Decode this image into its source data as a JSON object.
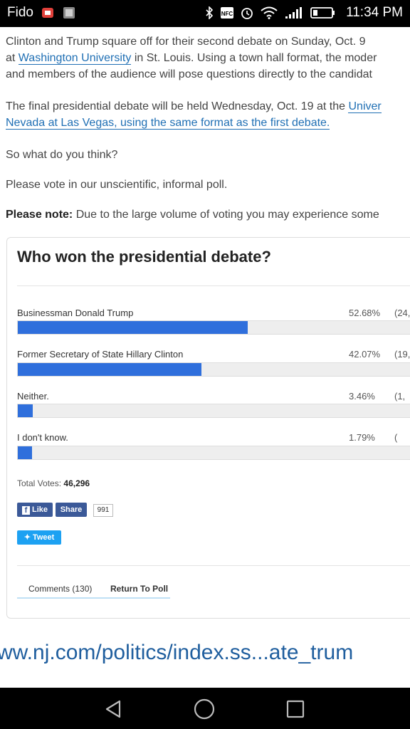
{
  "status_bar": {
    "carrier": "Fido",
    "time": "11:34 PM",
    "icons": [
      "app-notification-icon",
      "image-notification-icon",
      "bluetooth-icon",
      "nfc-icon",
      "alarm-icon",
      "wifi-icon",
      "signal-icon",
      "battery-icon"
    ]
  },
  "article": {
    "p1": {
      "line1": "Clinton and Trump square off for their second debate on Sunday, Oct. 9",
      "line2_pre": "at ",
      "line2_link": "Washington University",
      "line2_post": " in St. Louis. Using a town hall format, the moder",
      "line3": "and members of the audience will pose questions directly to the candidat"
    },
    "p2": {
      "line1_pre": "The final presidential debate will be held Wednesday, Oct. 19 at the ",
      "line1_link": "Univer",
      "line2_link": "Nevada at Las Vegas, using the same format as the first debate."
    },
    "p3": "So what do you think?",
    "p4": "Please vote in our unscientific, informal poll.",
    "p5": {
      "bold": "Please note:",
      "rest": " Due to the large volume of voting you may experience some"
    }
  },
  "poll": {
    "title": "Who won the presidential debate?",
    "options": [
      {
        "label": "Businessman Donald Trump",
        "percent_text": "52.68%",
        "count_text": "(24,",
        "fraction": 0.5268
      },
      {
        "label": "Former Secretary of State Hillary Clinton",
        "percent_text": "42.07%",
        "count_text": "(19,",
        "fraction": 0.4207
      },
      {
        "label": "Neither.",
        "percent_text": "3.46%",
        "count_text": "(1,",
        "fraction": 0.0346
      },
      {
        "label": "I don't know.",
        "percent_text": "1.79%",
        "count_text": "(",
        "fraction": 0.0179
      }
    ],
    "total_label": "Total Votes:",
    "total_value": "46,296",
    "like_label": "Like",
    "share_label": "Share",
    "share_count": "991",
    "tweet_label": "Tweet",
    "comments_label": "Comments (130)",
    "return_label": "Return To Poll",
    "bar_color": "#2f6fdc"
  },
  "url_bar": {
    "url": "ww.nj.com/politics/index.ss...ate_trum"
  },
  "nav_bar": {
    "icons": [
      "back-icon",
      "home-icon",
      "recents-icon"
    ]
  }
}
